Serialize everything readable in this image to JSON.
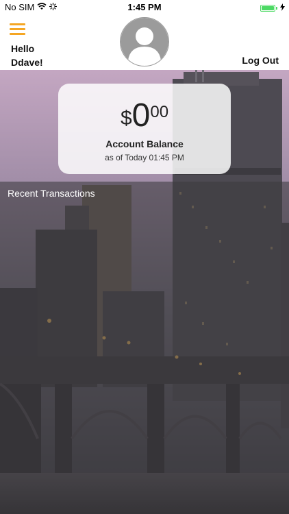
{
  "status_bar": {
    "carrier": "No SIM",
    "time": "1:45 PM",
    "wifi_icon": "wifi-icon",
    "activity_icon": "loading-spinner-icon",
    "battery_icon": "battery-icon",
    "charging_icon": "charging-bolt-icon"
  },
  "header": {
    "menu_icon": "hamburger-menu-icon",
    "greeting_line1": "Hello",
    "greeting_line2": "Ddave!",
    "logout_label": "Log Out",
    "avatar_icon": "user-avatar-icon"
  },
  "balance": {
    "currency": "$",
    "amount_int": "0",
    "amount_cents": "00",
    "label": "Account Balance",
    "as_of": "as of Today 01:45 PM"
  },
  "transactions": {
    "title": "Recent Transactions"
  },
  "colors": {
    "accent": "#f5a623",
    "battery": "#4cd964"
  }
}
